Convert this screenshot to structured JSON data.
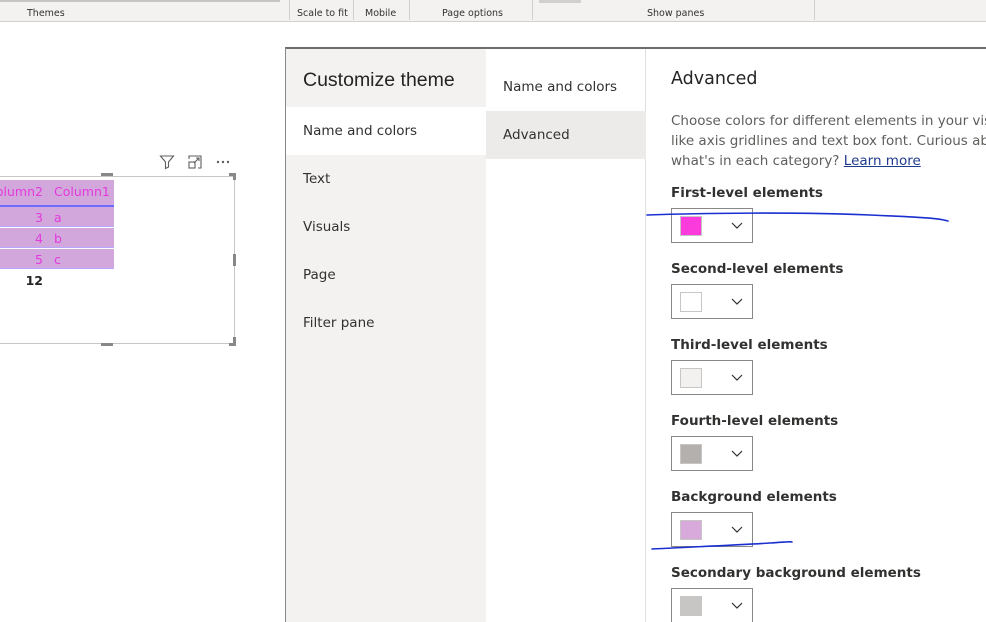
{
  "ribbon": {
    "groups": [
      "Themes",
      "Scale to fit",
      "Mobile",
      "Page options",
      "Show panes"
    ]
  },
  "table": {
    "headers": [
      "olumn2",
      "Column1"
    ],
    "rows": [
      {
        "col2": "3",
        "col1": "a"
      },
      {
        "col2": "4",
        "col1": "b"
      },
      {
        "col2": "5",
        "col1": "c"
      }
    ],
    "total": "12"
  },
  "visual_icons": [
    "filter-icon",
    "focus-mode-icon",
    "more-options-icon"
  ],
  "dialog": {
    "title": "Customize theme",
    "nav": [
      "Name and colors",
      "Text",
      "Visuals",
      "Page",
      "Filter pane"
    ],
    "subnav": [
      "Name and colors",
      "Advanced"
    ],
    "content": {
      "heading": "Advanced",
      "desc_line1": "Choose colors for different elements in your visuals",
      "desc_line2": "like axis gridlines and text box font. Curious about",
      "desc_line3": "what's in each category?",
      "learn_more": "Learn more",
      "elements": [
        {
          "label": "First-level elements",
          "color": "#fb3bdc"
        },
        {
          "label": "Second-level elements",
          "color": "#ffffff"
        },
        {
          "label": "Third-level elements",
          "color": "#f2f1f0"
        },
        {
          "label": "Fourth-level elements",
          "color": "#b4b0ae"
        },
        {
          "label": "Background elements",
          "color": "#d8aadb"
        },
        {
          "label": "Secondary background elements",
          "color": "#c8c6c4"
        }
      ]
    }
  },
  "colors": {
    "table_bg": "#d2a8dc",
    "table_text": "#e23adb",
    "ink": "#1a2fd0"
  }
}
